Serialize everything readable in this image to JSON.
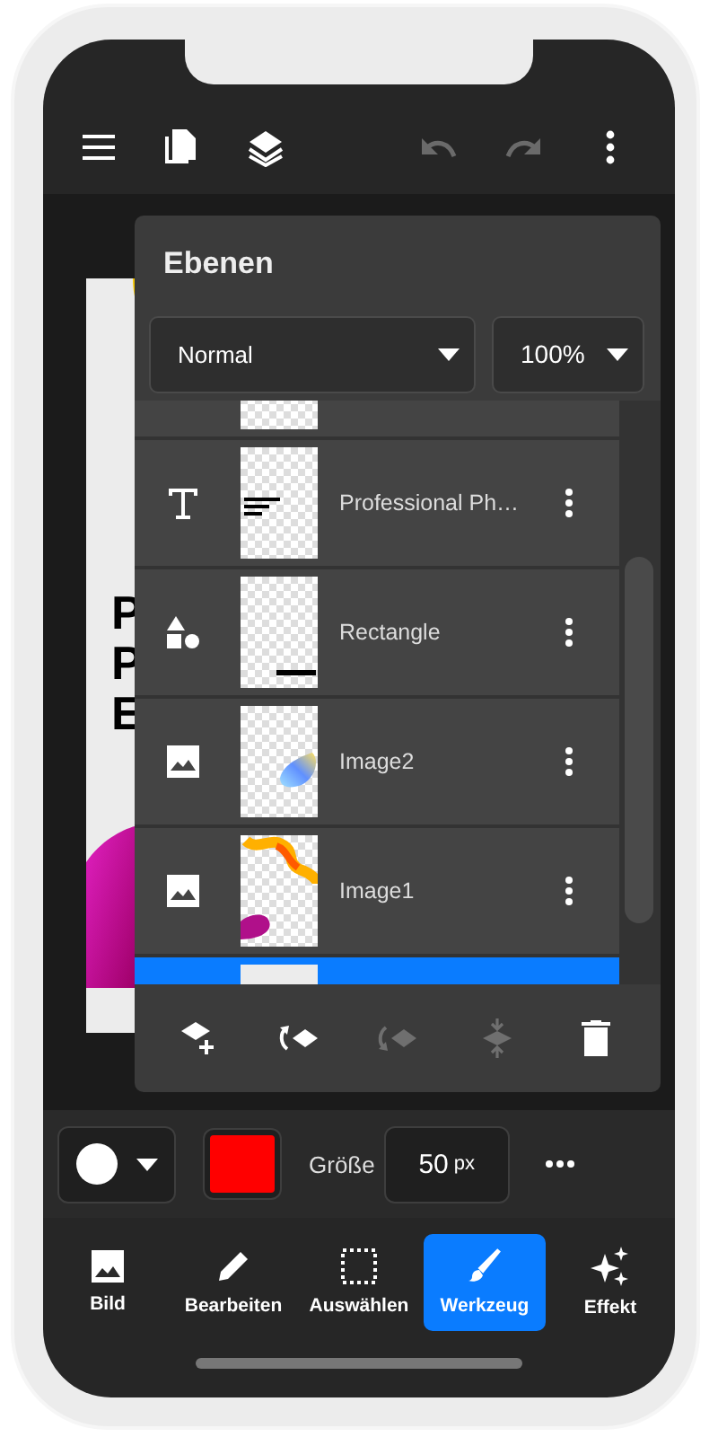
{
  "toolbar": [
    {
      "kind": "menu",
      "disabled": false
    },
    {
      "kind": "pages",
      "disabled": false
    },
    {
      "kind": "layers",
      "disabled": false
    },
    {
      "kind": "undo",
      "disabled": true
    },
    {
      "kind": "redo",
      "disabled": true
    },
    {
      "kind": "more",
      "disabled": false
    }
  ],
  "canvas_text": [
    "P",
    "P",
    "E"
  ],
  "panel": {
    "title": "Ebenen",
    "blend_mode": "Normal",
    "opacity": "100%",
    "layers": [
      {
        "selected": false
      },
      {
        "kind": "text",
        "name": "Professional Ph…",
        "selected": false
      },
      {
        "kind": "shape",
        "name": "Rectangle",
        "selected": false
      },
      {
        "kind": "image",
        "name": "Image2",
        "selected": false
      },
      {
        "kind": "image",
        "name": "Image1",
        "selected": false
      },
      {
        "selected": true
      }
    ],
    "actions": [
      {
        "kind": "add",
        "disabled": false
      },
      {
        "kind": "move-up",
        "disabled": false
      },
      {
        "kind": "move-down",
        "disabled": true
      },
      {
        "kind": "merge",
        "disabled": true
      },
      {
        "kind": "delete",
        "disabled": false
      }
    ]
  },
  "options": {
    "size_label": "Größe",
    "size_value": "50",
    "size_unit": "px",
    "color": "#ff0000"
  },
  "nav": [
    {
      "kind": "image",
      "label": "Bild",
      "selected": false
    },
    {
      "kind": "edit",
      "label": "Bearbeiten",
      "selected": false
    },
    {
      "kind": "select",
      "label": "Auswählen",
      "selected": false
    },
    {
      "kind": "tool",
      "label": "Werkzeug",
      "selected": true
    },
    {
      "kind": "effect",
      "label": "Effekt",
      "selected": false
    }
  ]
}
